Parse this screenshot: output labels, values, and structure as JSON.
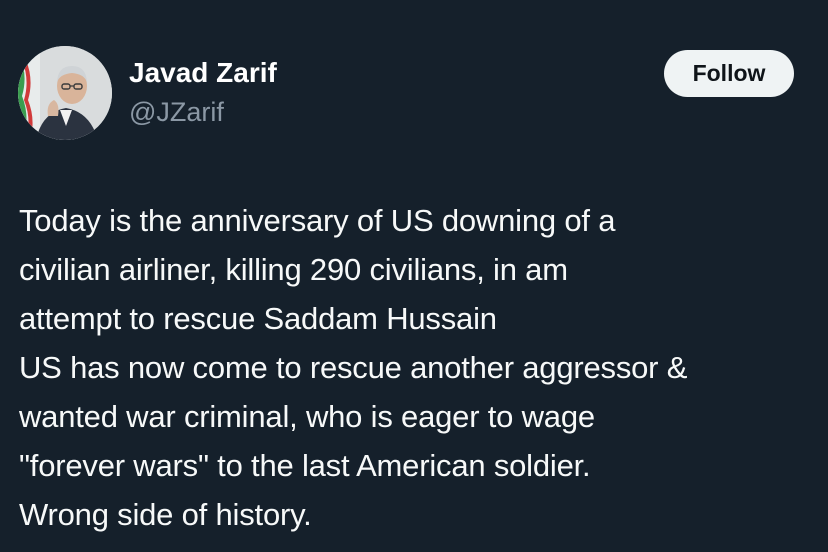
{
  "author": {
    "display_name": "Javad Zarif",
    "handle": "@JZarif",
    "avatar_icon": "profile-photo"
  },
  "actions": {
    "follow_label": "Follow"
  },
  "tweet": {
    "lines": [
      "Today is the anniversary of US downing of a",
      "civilian airliner, killing 290 civilians, in am",
      "attempt to rescue Saddam Hussain",
      "US has now come to rescue another aggressor &",
      "wanted war criminal, who is eager to wage",
      "\"forever wars\" to the last American soldier.",
      "Wrong side of history."
    ]
  },
  "colors": {
    "background": "#15202b",
    "text": "#f7f9f9",
    "secondary_text": "#8b98a5",
    "button_bg": "#eff3f4",
    "button_text": "#0f1419"
  }
}
